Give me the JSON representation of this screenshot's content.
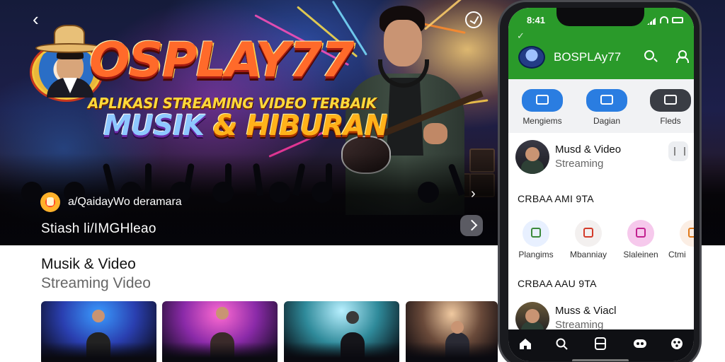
{
  "hero": {
    "back_icon": "chevron-left-icon",
    "top_right_icon": "check-circle-icon",
    "brand": "OSPLAY77",
    "tagline": "APLIKASI STREAMING VIDEO TERBAIK",
    "headline_part1": "MUSIK",
    "headline_part2": " & HIBURAN",
    "channel_name": "a/QaidayWo deramara",
    "subtitle": "Stiash li/IMGHleao",
    "share_icon": "chevron-right-icon",
    "next_icon": "chevron-right-icon"
  },
  "section": {
    "title": "Musik & Video",
    "subtitle": "Streaming Video"
  },
  "phone": {
    "time": "8:41",
    "app_title": "BOSPLAy77",
    "quick_actions": [
      {
        "label": "Mengiems",
        "color": "#2a7de1",
        "icon": "image-icon"
      },
      {
        "label": "Dagian",
        "color": "#2a7de1",
        "icon": "chart-icon"
      },
      {
        "label": "Fleds",
        "color": "#3a3d44",
        "icon": "media-icon"
      }
    ],
    "row1": {
      "title": "Musd & Video",
      "subtitle": "Streaming"
    },
    "section1_head": "CRBAA AMI 9TA",
    "categories": [
      {
        "label": "Plangims",
        "color": "#e8f0ff",
        "glyph": "#3b8a3b",
        "icon": "map-pin-icon"
      },
      {
        "label": "Mbanniay",
        "color": "#f3f0ef",
        "glyph": "#d33b2a",
        "icon": "edit-icon"
      },
      {
        "label": "Slaleinen",
        "color": "#f6c9ec",
        "glyph": "#c2208f",
        "icon": "chat-icon"
      },
      {
        "label": "Ctmi",
        "color": "#fbeee4",
        "glyph": "#e07a1a",
        "icon": "folder-icon"
      }
    ],
    "section2_head": "CRBAA AAU 9TA",
    "row2": {
      "title": "Muss & Viacl",
      "subtitle": "Streaming"
    },
    "nav": [
      "home-icon",
      "search-icon",
      "library-icon",
      "game-icon",
      "profile-icon"
    ]
  },
  "colors": {
    "appbar": "#2a9a2a",
    "brand_orange": "#ff6a2a",
    "tagline_yellow": "#ffd93a"
  }
}
